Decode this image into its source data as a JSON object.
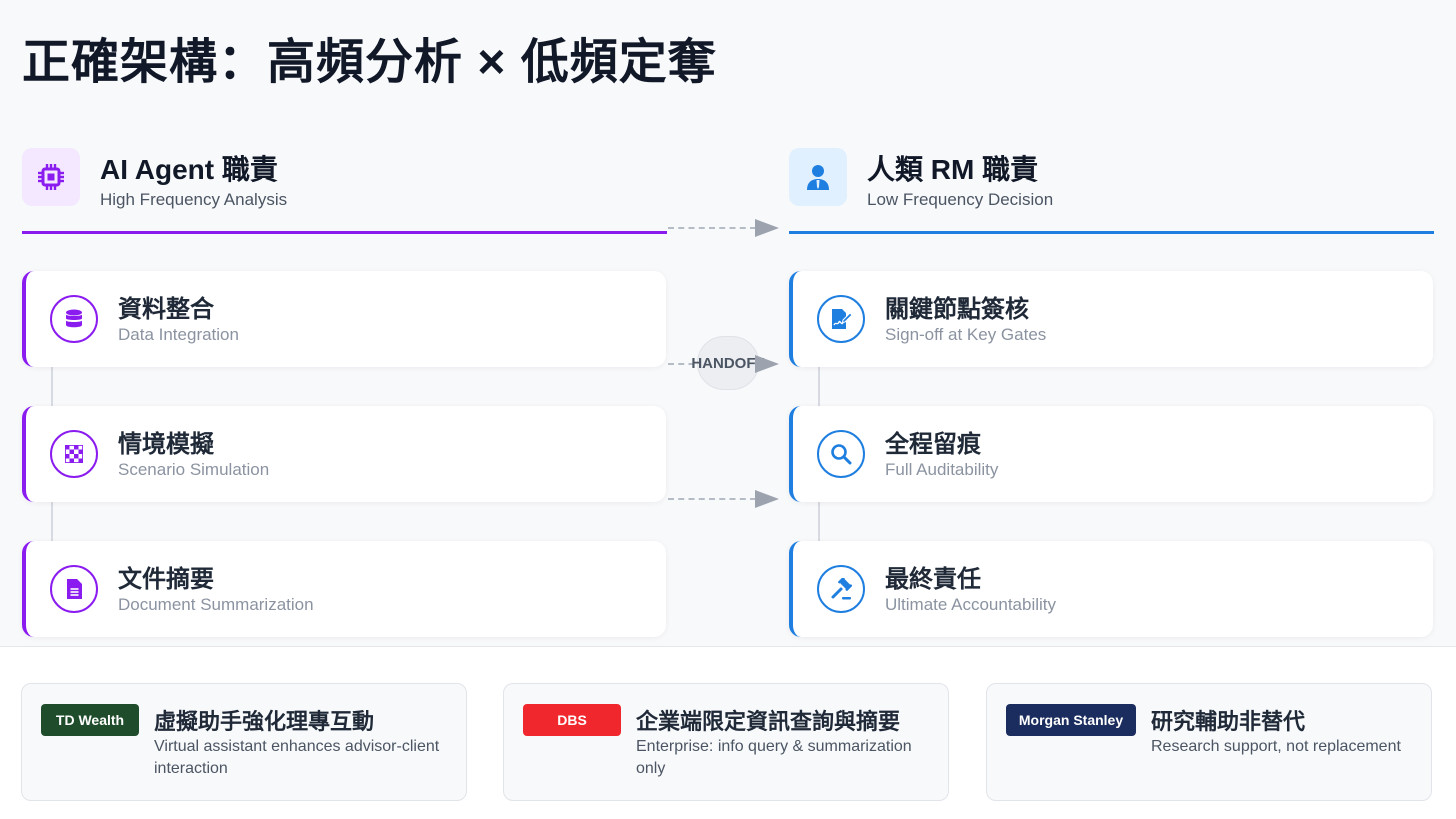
{
  "title": "正確架構：高頻分析 × 低頻定奪",
  "left_column": {
    "title": "AI Agent 職責",
    "subtitle": "High Frequency Analysis",
    "icon": "cpu-chip-icon",
    "accent": "#8b1cf0",
    "items": [
      {
        "title": "資料整合",
        "subtitle": "Data Integration",
        "icon": "database-icon"
      },
      {
        "title": "情境模擬",
        "subtitle": "Scenario Simulation",
        "icon": "chessboard-icon"
      },
      {
        "title": "文件摘要",
        "subtitle": "Document Summarization",
        "icon": "document-icon"
      }
    ]
  },
  "right_column": {
    "title": "人類 RM 職責",
    "subtitle": "Low Frequency Decision",
    "icon": "user-tie-icon",
    "accent": "#1f7fe0",
    "items": [
      {
        "title": "關鍵節點簽核",
        "subtitle": "Sign-off at Key Gates",
        "icon": "file-signature-icon"
      },
      {
        "title": "全程留痕",
        "subtitle": "Full Auditability",
        "icon": "magnifier-icon"
      },
      {
        "title": "最終責任",
        "subtitle": "Ultimate Accountability",
        "icon": "gavel-icon"
      }
    ]
  },
  "handoff_label": "HANDOFF",
  "examples": [
    {
      "badge": "TD Wealth",
      "badge_color": "#1f4d2b",
      "title": "虛擬助手強化理專互動",
      "subtitle": "Virtual assistant enhances advisor-client interaction"
    },
    {
      "badge": "DBS",
      "badge_color": "#f0282d",
      "title": "企業端限定資訊查詢與摘要",
      "subtitle": "Enterprise: info query & summarization only"
    },
    {
      "badge": "Morgan Stanley",
      "badge_color": "#1b2d5e",
      "title": "研究輔助非替代",
      "subtitle": "Research support, not replacement"
    }
  ]
}
